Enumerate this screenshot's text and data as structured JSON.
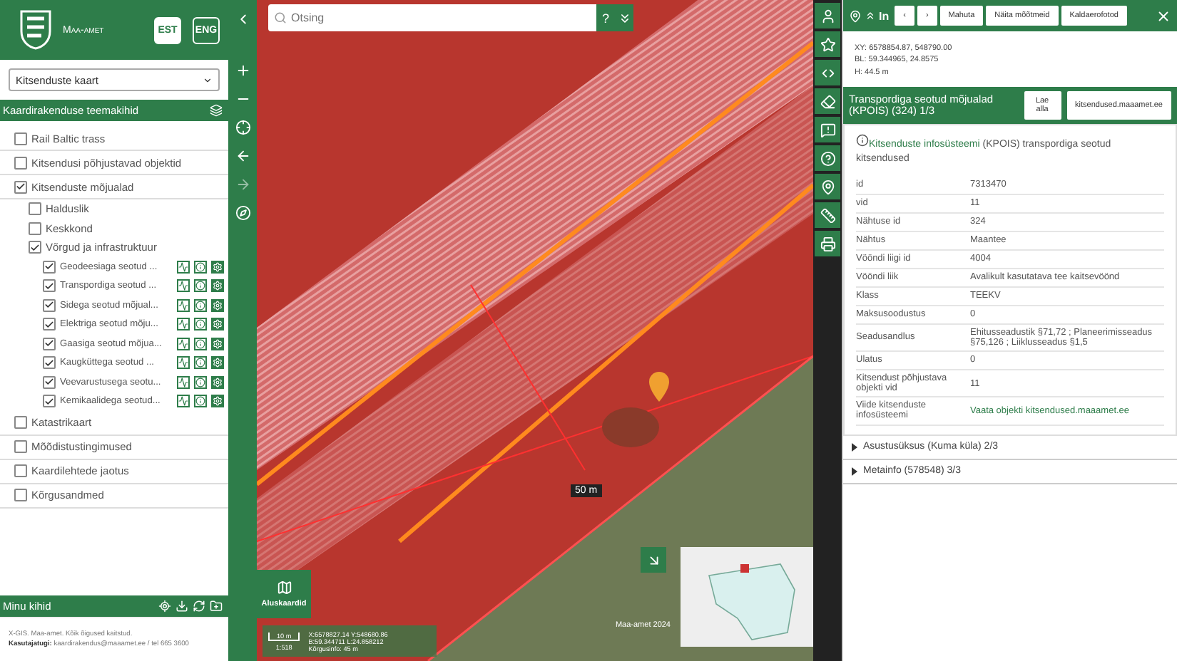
{
  "brand": {
    "name": "Maa-amet",
    "languages": [
      {
        "label": "EST",
        "selected": true
      },
      {
        "label": "ENG",
        "selected": false
      }
    ]
  },
  "map_select": {
    "value": "Kitsenduste kaart"
  },
  "themes": {
    "title": "Kaardirakenduse teemakihid",
    "layers": [
      {
        "label": "Rail Baltic trass",
        "checked": false
      },
      {
        "label": "Kitsendusi põhjustavad objektid",
        "checked": false
      },
      {
        "label": "Kitsenduste mõjualad",
        "checked": true,
        "children": [
          {
            "label": "Halduslik",
            "checked": false
          },
          {
            "label": "Keskkond",
            "checked": false
          },
          {
            "label": "Võrgud ja infrastruktuur",
            "checked": true,
            "children": [
              {
                "label": "Geodeesiaga seotud ...",
                "checked": true,
                "actions": true
              },
              {
                "label": "Transpordiga seotud ...",
                "checked": true,
                "actions": true
              },
              {
                "label": "Sidega seotud mõjual...",
                "checked": true,
                "actions": true
              },
              {
                "label": "Elektriga seotud mõju...",
                "checked": true,
                "actions": true
              },
              {
                "label": "Gaasiga seotud mõjua...",
                "checked": true,
                "actions": true
              },
              {
                "label": "Kaugküttega seotud ...",
                "checked": true,
                "actions": true
              },
              {
                "label": "Veevarustusega seotu...",
                "checked": true,
                "actions": true
              },
              {
                "label": "Kemikaalidega seotud...",
                "checked": true,
                "actions": true
              }
            ]
          }
        ]
      },
      {
        "label": "Katastrikaart",
        "checked": false
      },
      {
        "label": "Mõõdistustingimused",
        "checked": false
      },
      {
        "label": "Kaardilehtede jaotus",
        "checked": false
      },
      {
        "label": "Kõrgusandmed",
        "checked": false
      }
    ]
  },
  "my_layers": {
    "title": "Minu kihid"
  },
  "footer": {
    "line1": "X-GIS. Maa-amet. Kõik õigused kaitstud.",
    "support_label": "Kasutajatugi:",
    "support_text": "kaardirakendus@maaamet.ee / tel 665 3600"
  },
  "search": {
    "placeholder": "Otsing",
    "help": "?"
  },
  "map": {
    "measure_label": "50 m",
    "basemaps_label": "Aluskaardid",
    "scale_bar": "10 m",
    "scale": "1:518",
    "cursor_xy": "X:6578827.14 Y:548680.86",
    "cursor_bl": "B:59.344711 L:24.858212",
    "cursor_h": "Kõrgusinfo: 45 m",
    "copyright": "Maa-amet 2024"
  },
  "info_panel": {
    "title": "In",
    "buttons": [
      "‹",
      "›",
      "Mahuta",
      "Näita mõõtmeid",
      "Kaldaerofotod"
    ],
    "coords": [
      "XY: 6578854.87, 548790.00",
      "BL: 59.344965, 24.8575",
      "H: 44.5 m"
    ],
    "sections": [
      {
        "title": "Transpordiga seotud mõjualad (KPOIS) (324) 1/3",
        "expanded": true,
        "buttons": [
          "Lae alla",
          "kitsendused.maaamet.ee"
        ],
        "description_link": "Kitsenduste infosüsteemi",
        "description": " (KPOIS) transpordiga seotud kitsendused",
        "rows": [
          {
            "key": "id",
            "value": "7313470"
          },
          {
            "key": "vid",
            "value": "11"
          },
          {
            "key": "Nähtuse id",
            "value": "324"
          },
          {
            "key": "Nähtus",
            "value": "Maantee"
          },
          {
            "key": "Vööndi liigi id",
            "value": "4004"
          },
          {
            "key": "Vööndi liik",
            "value": "Avalikult kasutatava tee kaitsevöönd"
          },
          {
            "key": "Klass",
            "value": "TEEKV"
          },
          {
            "key": "Maksusoodustus",
            "value": "0"
          },
          {
            "key": "Seadusandlus",
            "value": "Ehitusseadustik §71,72 ; Planeerimisseadus §75,126 ; Liiklusseadus §1,5"
          },
          {
            "key": "Ulatus",
            "value": "0"
          },
          {
            "key": "Kitsendust põhjustava objekti vid",
            "value": "11"
          },
          {
            "key": "Viide kitsenduste infosüsteemi",
            "value": "Vaata objekti kitsendused.maaamet.ee",
            "kind": "link"
          }
        ]
      },
      {
        "title": "Asustusüksus (Kuma küla) 2/3",
        "expanded": false
      },
      {
        "title": "Metainfo (578548) 3/3",
        "expanded": false
      }
    ]
  }
}
